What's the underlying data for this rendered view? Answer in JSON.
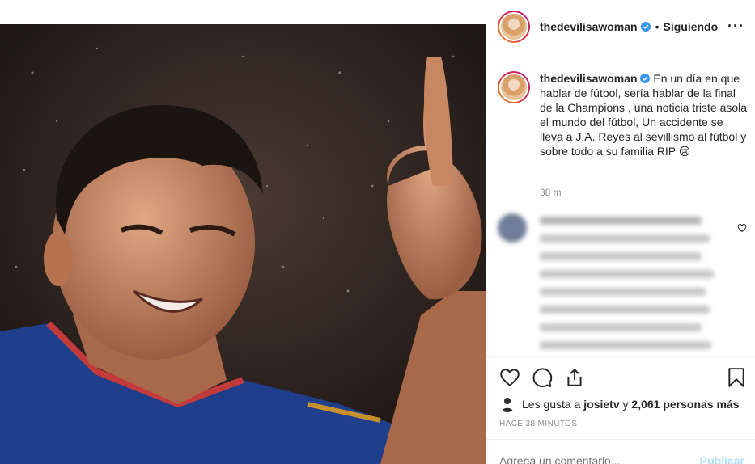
{
  "post": {
    "username": "thedevilisawoman",
    "follow_status": "Siguiendo",
    "separator": "•",
    "more": "···",
    "caption": "En un día en que hablar de fútbol, sería hablar de la final de la Champions , una noticia triste asola el mundo del fútbol, Un accidente se lleva a J.A. Reyes al sevillismo al fútbol y sobre todo a su familia RIP 😢",
    "caption_time": "38 m",
    "likes_prefix": "Les gusta a",
    "likes_user": "josietv",
    "likes_joiner": "y",
    "likes_others": "2,061 personas más",
    "time_ago": "HACE 38 MINUTOS",
    "comment_placeholder": "Agrega un comentario...",
    "post_label": "Publicar"
  },
  "icons": {
    "verified": "verified-badge-icon",
    "like": "heart-icon",
    "comment": "comment-bubble-icon",
    "share": "share-icon",
    "save": "bookmark-icon",
    "comment_like": "heart-icon"
  },
  "colors": {
    "verified_blue": "#3897f0",
    "muted_text": "#8e8e8e",
    "post_button_disabled": "#b2dffc",
    "divider": "#efefef"
  }
}
